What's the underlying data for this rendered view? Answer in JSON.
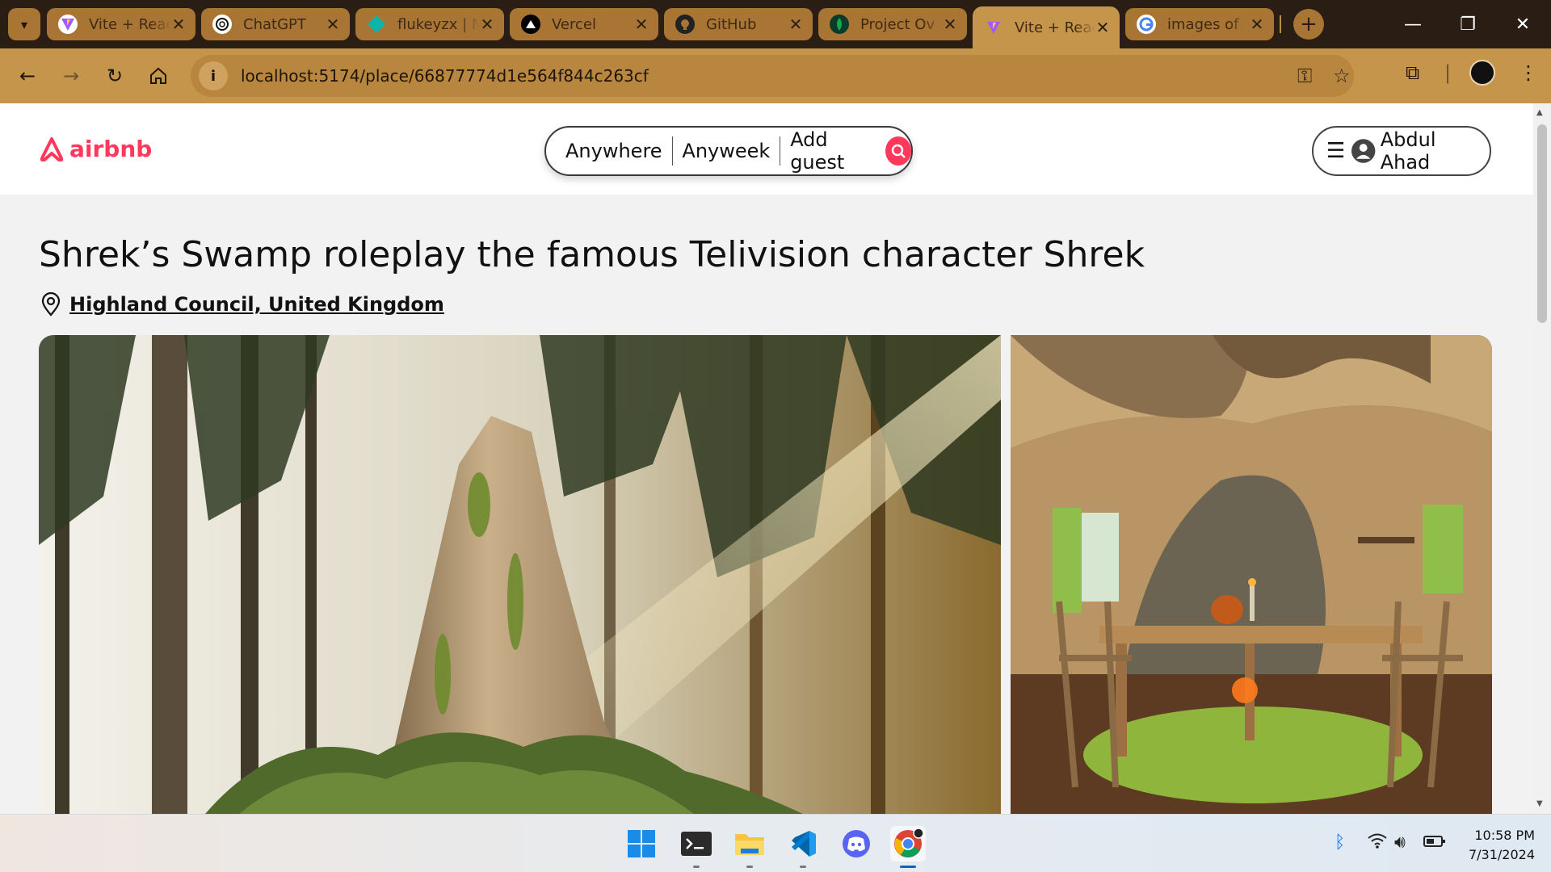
{
  "browser": {
    "tabs": [
      {
        "title": "Vite + React",
        "icon": "vite-icon",
        "color": "#a15cff"
      },
      {
        "title": "ChatGPT",
        "icon": "chatgpt-icon",
        "color": "#111111"
      },
      {
        "title": "flukeyzx | N",
        "icon": "diamond-icon",
        "color": "#0fb4a8"
      },
      {
        "title": "Vercel",
        "icon": "vercel-icon",
        "color": "#000000"
      },
      {
        "title": "GitHub",
        "icon": "github-icon",
        "color": "#222222"
      },
      {
        "title": "Project Ov",
        "icon": "mongodb-icon",
        "color": "#0c3b2a"
      },
      {
        "title": "Vite + React",
        "icon": "vite-icon",
        "color": "#a15cff",
        "active": true
      },
      {
        "title": "images of",
        "icon": "google-icon",
        "color": "#ffffff"
      }
    ],
    "url": "localhost:5174/place/66877774d1e564f844c263cf"
  },
  "header": {
    "brand": "airbnb",
    "search": {
      "where": "Anywhere",
      "when": "Anyweek",
      "who": "Add guest"
    },
    "user_name": "Abdul Ahad"
  },
  "place": {
    "title": "Shrek’s Swamp roleplay the famous Telivision character Shrek",
    "location": "Highland Council, United Kingdom"
  },
  "taskbar": {
    "apps": [
      "windows-start-icon",
      "terminal-icon",
      "file-explorer-icon",
      "vscode-icon",
      "discord-icon",
      "chrome-icon"
    ],
    "time": "10:58 PM",
    "date": "7/31/2024"
  },
  "colors": {
    "brand": "#ff385c",
    "chrome_frame": "#2a1e14",
    "chrome_toolbar": "#c5954c"
  }
}
